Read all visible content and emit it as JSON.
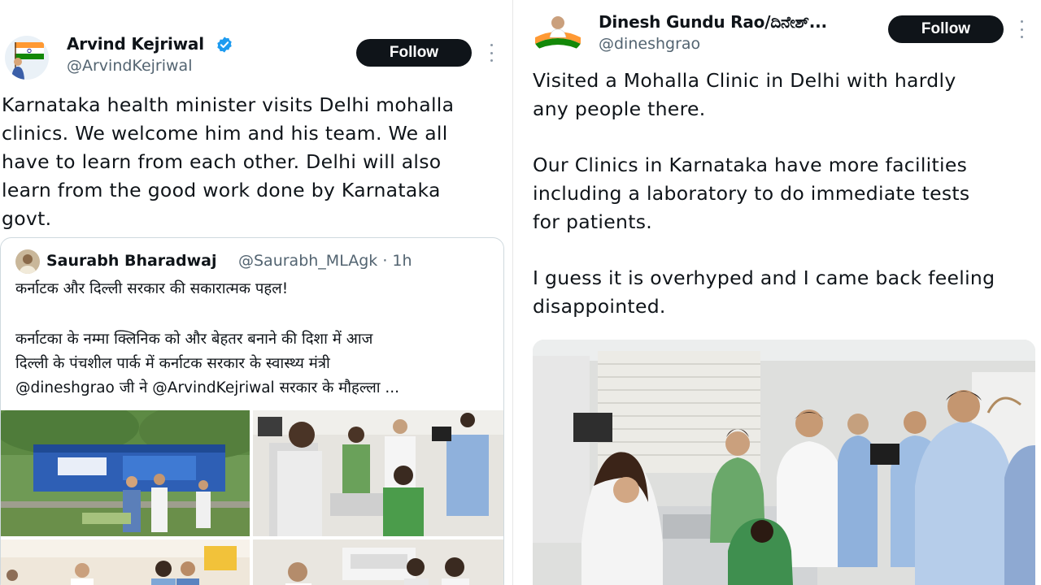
{
  "left_tweet": {
    "author_name": "Arvind Kejriwal",
    "handle": "@ArvindKejriwal",
    "verified": true,
    "follow_label": "Follow",
    "text_lines": [
      "Karnataka health minister visits Delhi mohalla",
      "clinics. We welcome him and his team. We all",
      "have to learn from each other. Delhi will also",
      "learn from the good work done by Karnataka",
      "govt."
    ],
    "quote": {
      "author_name": "Saurabh Bharadwaj",
      "handle": "@Saurabh_MLAgk",
      "separator": "·",
      "time": "1h",
      "line1": "कर्नाटक और दिल्ली सरकार की सकारात्मक पहल!",
      "line2": "कर्नाटका के नम्मा क्लिनिक को और बेहतर बनाने की दिशा में आज",
      "line3": "दिल्ली के पंचशील पार्क में कर्नाटक सरकार के स्वास्थ्य मंत्री",
      "line4": "@dineshgrao जी ने @ArvindKejriwal सरकार के मौहल्ला ..."
    }
  },
  "right_tweet": {
    "author_name": "Dinesh Gundu Rao/ದಿನೇಶ್...",
    "handle": "@dineshgrao",
    "follow_label": "Follow",
    "paragraph1": [
      "Visited a Mohalla Clinic in Delhi with hardly",
      "any people there."
    ],
    "paragraph2": [
      "Our Clinics in Karnataka have more facilities",
      "including a laboratory to do immediate tests",
      "for patients."
    ],
    "paragraph3": [
      "I guess it is overhyped and I came back feeling",
      "disappointed."
    ]
  },
  "colors": {
    "follow_bg": "#0f1419",
    "verified_blue": "#1d9bf0",
    "muted_text": "#536471",
    "border": "#cfd9de"
  },
  "icons": [
    "verified-badge-icon",
    "more-options-icon"
  ]
}
